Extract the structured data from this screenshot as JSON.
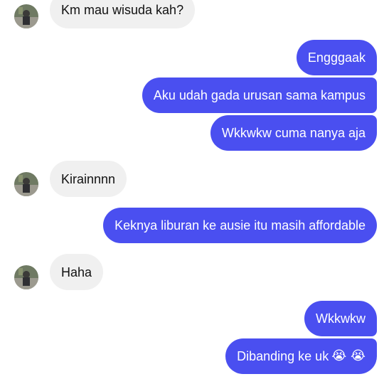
{
  "colors": {
    "incoming_bubble": "#f0f0f0",
    "outgoing_bubble": "#4a4ff0",
    "outgoing_text": "#ffffff",
    "incoming_text": "#111111"
  },
  "messages": [
    {
      "side": "in",
      "text": "Km mau wisuda kah?"
    },
    {
      "side": "out",
      "text": "Engggaak"
    },
    {
      "side": "out",
      "text": "Aku udah gada urusan sama kampus"
    },
    {
      "side": "out",
      "text": "Wkkwkw cuma nanya aja"
    },
    {
      "side": "in",
      "text": "Kirainnnn"
    },
    {
      "side": "out",
      "text": "Keknya liburan ke ausie itu masih affordable"
    },
    {
      "side": "in",
      "text": "Haha"
    },
    {
      "side": "out",
      "text": "Wkkwkw"
    },
    {
      "side": "out",
      "text": "Dibanding ke uk",
      "emoji": "😭 😭"
    }
  ]
}
